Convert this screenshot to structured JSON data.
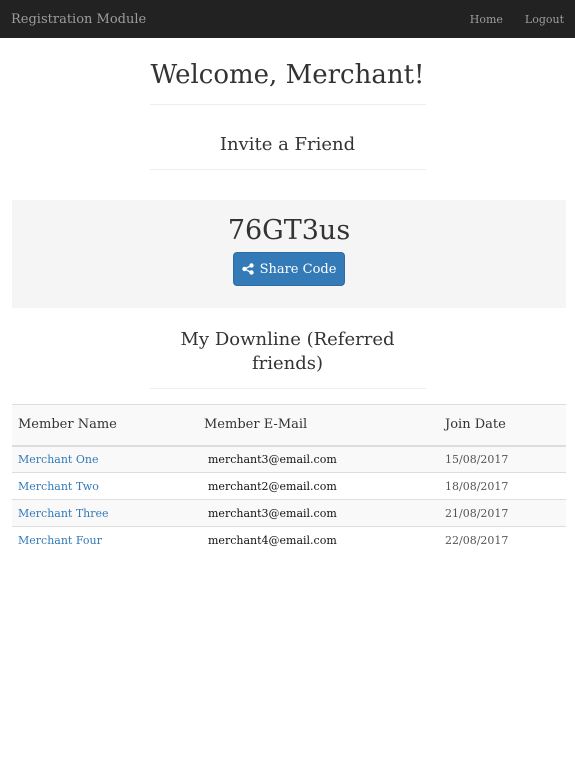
{
  "navbar": {
    "brand": "Registration Module",
    "links": [
      "Home",
      "Logout"
    ]
  },
  "welcome": {
    "title": "Welcome, Merchant!"
  },
  "invite": {
    "title": "Invite a Friend",
    "code": "76GT3us",
    "share_button": {
      "label": "Share Code",
      "icon": "share-icon"
    }
  },
  "downline": {
    "title": "My Downline (Referred friends)",
    "columns": [
      "Member Name",
      "Member E-Mail",
      "Join Date"
    ],
    "rows": [
      {
        "name": "Merchant One",
        "email": "merchant3@email.com",
        "date": "15/08/2017"
      },
      {
        "name": "Merchant Two",
        "email": "merchant2@email.com",
        "date": "18/08/2017"
      },
      {
        "name": "Merchant Three",
        "email": "merchant3@email.com",
        "date": "21/08/2017"
      },
      {
        "name": "Merchant Four",
        "email": "merchant4@email.com",
        "date": "22/08/2017"
      }
    ]
  },
  "colors": {
    "navbar_bg": "#222222",
    "primary_button": "#337ab7",
    "link": "#337ab7",
    "code_panel_bg": "#f5f5f5"
  }
}
